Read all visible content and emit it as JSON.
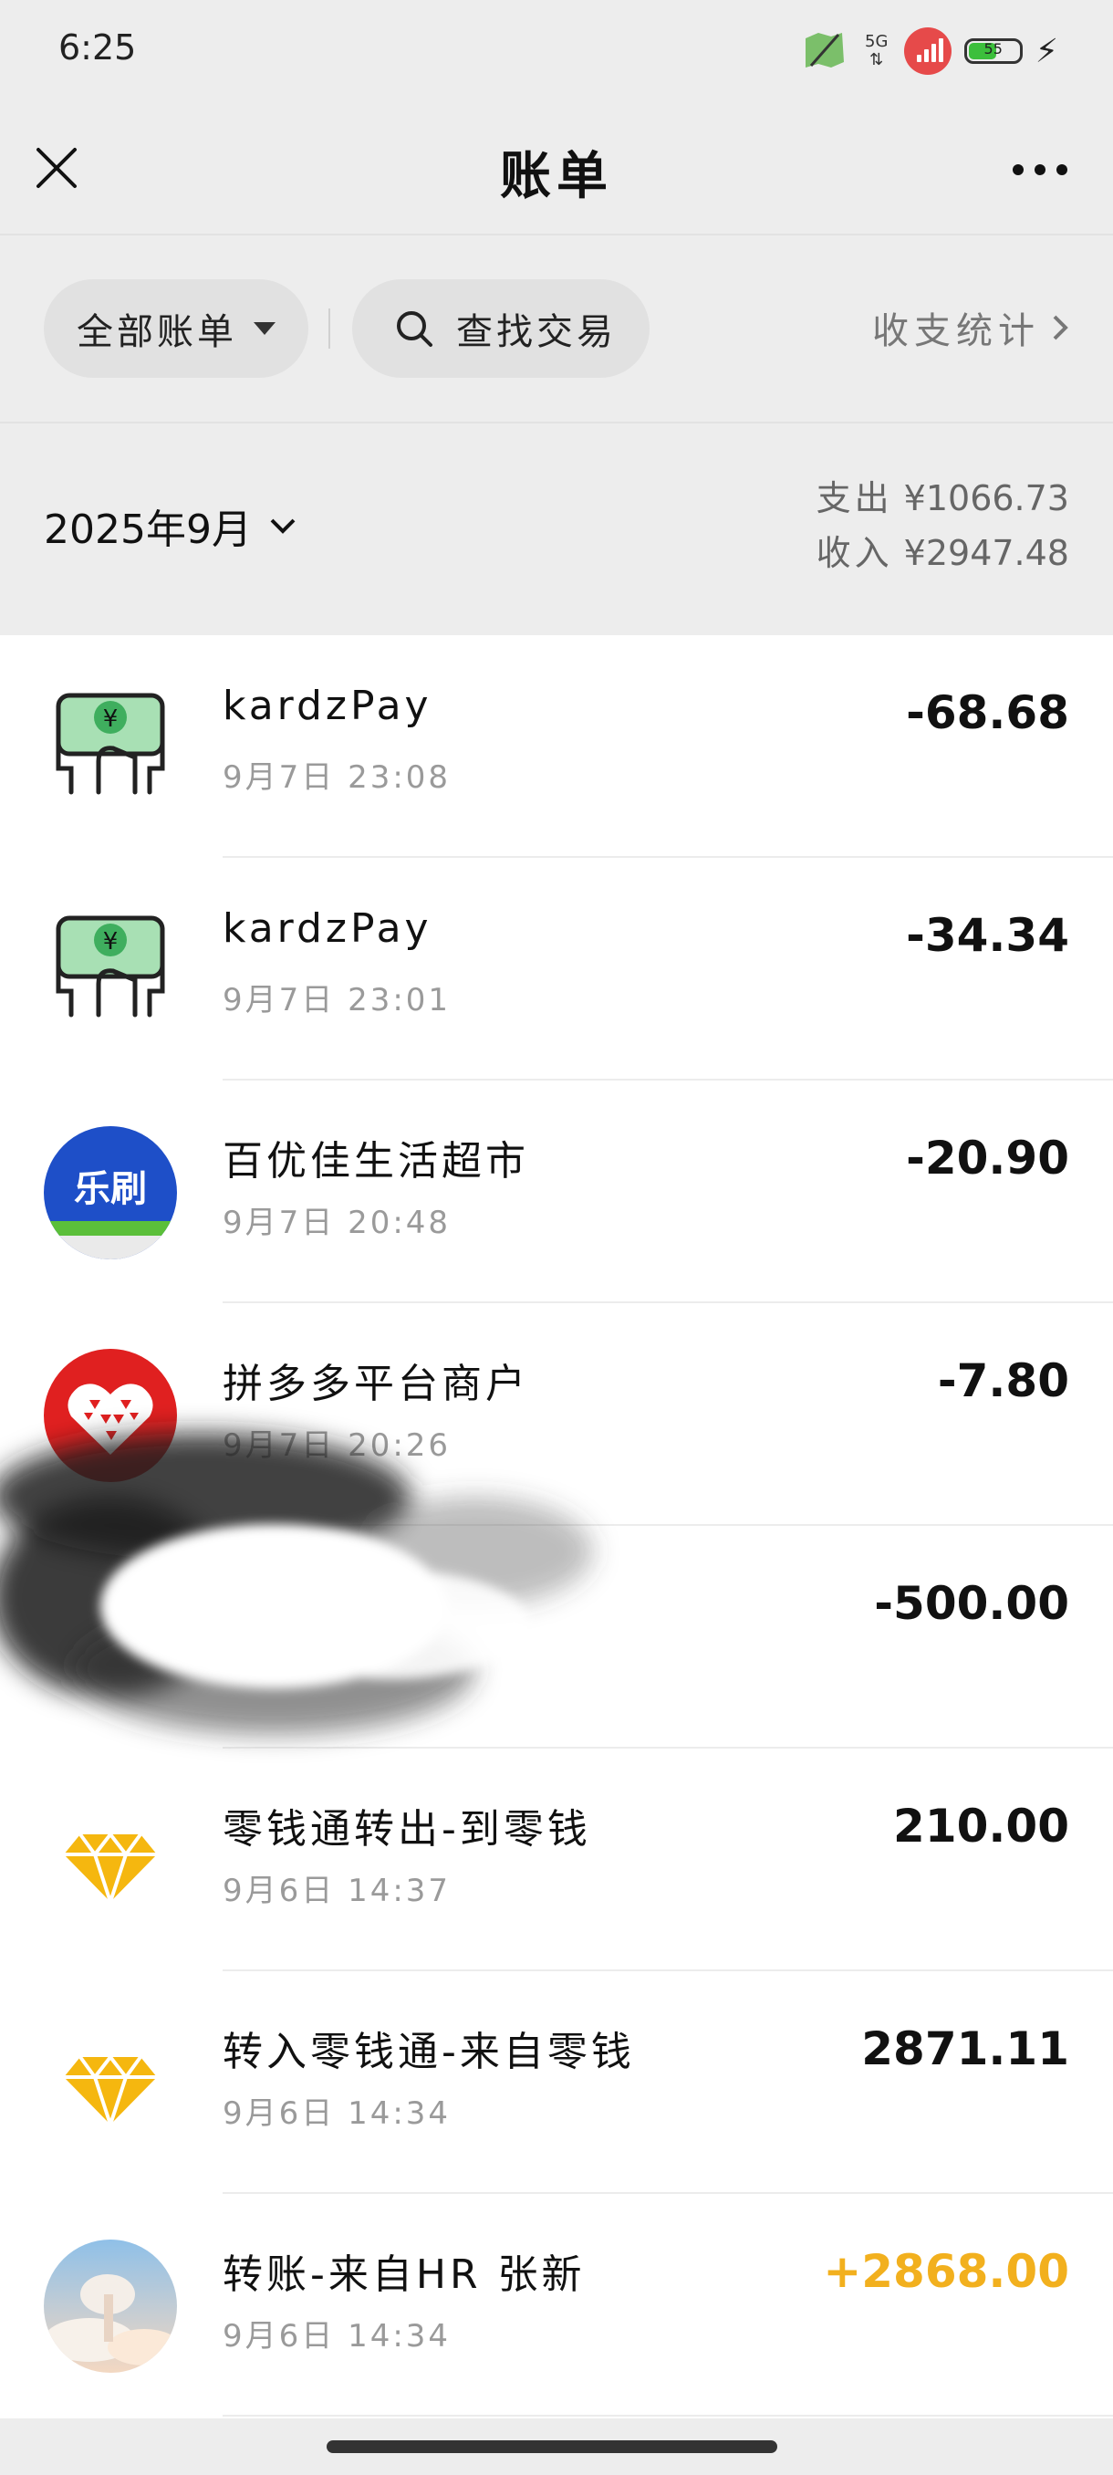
{
  "status_bar": {
    "time": "6:25",
    "network": "5G",
    "battery": "55",
    "battery_level": 0.55,
    "accent_colors": {
      "signal": "#e64a4a",
      "battery": "#3cbf3c"
    }
  },
  "nav": {
    "title": "账单",
    "close_icon": "close-icon",
    "more_icon": "more-icon"
  },
  "filters": {
    "all_bills": "全部账单",
    "search": "查找交易",
    "stats": "收支统计"
  },
  "month": {
    "label": "2025年9月",
    "expense_label": "支出",
    "expense": "¥1066.73",
    "income_label": "收入",
    "income": "¥2947.48"
  },
  "transactions": [
    {
      "icon": "qr-pay-icon",
      "title": "kardzPay",
      "time": "9月7日 23:08",
      "amount": "-68.68",
      "type": "expense"
    },
    {
      "icon": "qr-pay-icon",
      "title": "kardzPay",
      "time": "9月7日 23:01",
      "amount": "-34.34",
      "type": "expense"
    },
    {
      "icon": "leshua-logo-icon",
      "logo_text": "乐刷",
      "title": "百优佳生活超市",
      "time": "9月7日 20:48",
      "amount": "-20.90",
      "type": "expense"
    },
    {
      "icon": "pinduoduo-logo-icon",
      "title": "拼多多平台商户",
      "time": "9月7日 20:26",
      "amount": "-7.80",
      "type": "expense"
    },
    {
      "icon": "",
      "title": "",
      "time": "",
      "amount": "-500.00",
      "type": "expense"
    },
    {
      "icon": "diamond-icon",
      "title": "零钱通转出-到零钱",
      "time": "9月6日 14:37",
      "amount": "210.00",
      "type": "transfer"
    },
    {
      "icon": "diamond-icon",
      "title": "转入零钱通-来自零钱",
      "time": "9月6日 14:34",
      "amount": "2871.11",
      "type": "transfer"
    },
    {
      "icon": "avatar-sky-icon",
      "title": "转账-来自HR 张新",
      "time": "9月6日 14:34",
      "amount": "+2868.00",
      "type": "income"
    }
  ],
  "colors": {
    "income": "#f2b01e",
    "leshua_blue": "#1e4fc8",
    "pinduoduo_red": "#e02020",
    "diamond_gold": "#f5b70f",
    "pay_green": "#6ecb8a"
  }
}
